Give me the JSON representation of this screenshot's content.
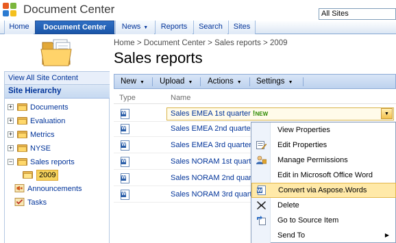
{
  "title_bar": {
    "site_title": "Document Center",
    "site_select_value": "All Sites"
  },
  "topnav": {
    "tabs": [
      {
        "label": "Home",
        "dropdown": false
      },
      {
        "label": "Document Center",
        "dropdown": false,
        "active": true
      },
      {
        "label": "News",
        "dropdown": true
      },
      {
        "label": "Reports",
        "dropdown": false
      },
      {
        "label": "Search",
        "dropdown": false
      },
      {
        "label": "Sites",
        "dropdown": false
      }
    ]
  },
  "breadcrumb": {
    "items": [
      "Home",
      "Document Center",
      "Sales reports",
      "2009"
    ],
    "separator": ">"
  },
  "page_title": "Sales reports",
  "leftnav": {
    "view_all": "View All Site Content",
    "section_title": "Site Hierarchy",
    "tree": [
      {
        "label": "Documents",
        "icon": "folder-icon",
        "expander": "+"
      },
      {
        "label": "Evaluation",
        "icon": "folder-icon",
        "expander": "+"
      },
      {
        "label": "Metrics",
        "icon": "folder-icon",
        "expander": "+"
      },
      {
        "label": "NYSE",
        "icon": "folder-icon",
        "expander": "+"
      },
      {
        "label": "Sales reports",
        "icon": "folder-icon",
        "expander": "−"
      },
      {
        "label": "2009",
        "icon": "open-folder-icon",
        "selected": true
      },
      {
        "label": "Announcements",
        "icon": "announcements-icon"
      },
      {
        "label": "Tasks",
        "icon": "tasks-icon"
      }
    ]
  },
  "toolbar": {
    "buttons": [
      "New",
      "Upload",
      "Actions",
      "Settings"
    ]
  },
  "columns": {
    "type": "Type",
    "name": "Name"
  },
  "rows": [
    {
      "name": "Sales EMEA 1st quarter",
      "selected": true,
      "new": true
    },
    {
      "name": "Sales EMEA 2nd quarter"
    },
    {
      "name": "Sales EMEA 3rd quarter"
    },
    {
      "name": "Sales NORAM 1st quarter"
    },
    {
      "name": "Sales NORAM 2nd quarter"
    },
    {
      "name": "Sales NORAM 3rd quarter"
    }
  ],
  "new_badge": {
    "bang": "!",
    "text": "NEW"
  },
  "context_menu": {
    "items": [
      {
        "label": "View Properties",
        "icon": ""
      },
      {
        "label": "Edit Properties",
        "icon": "edit-properties-icon"
      },
      {
        "label": "Manage Permissions",
        "icon": "permissions-icon"
      },
      {
        "label": "Edit in Microsoft Office Word",
        "icon": "word-icon"
      },
      {
        "label": "Convert via Aspose.Words",
        "icon": "aspose-words-icon",
        "highlighted": true
      },
      {
        "label": "Delete",
        "icon": "delete-icon"
      },
      {
        "label": "Go to Source Item",
        "icon": "source-item-icon"
      },
      {
        "label": "Send To",
        "icon": "",
        "submenu": true
      }
    ]
  },
  "colors": {
    "accent": "#003399",
    "tab_active": "#2f6fc4",
    "highlight": "#ffe9a8",
    "selection": "#f6d35c"
  }
}
